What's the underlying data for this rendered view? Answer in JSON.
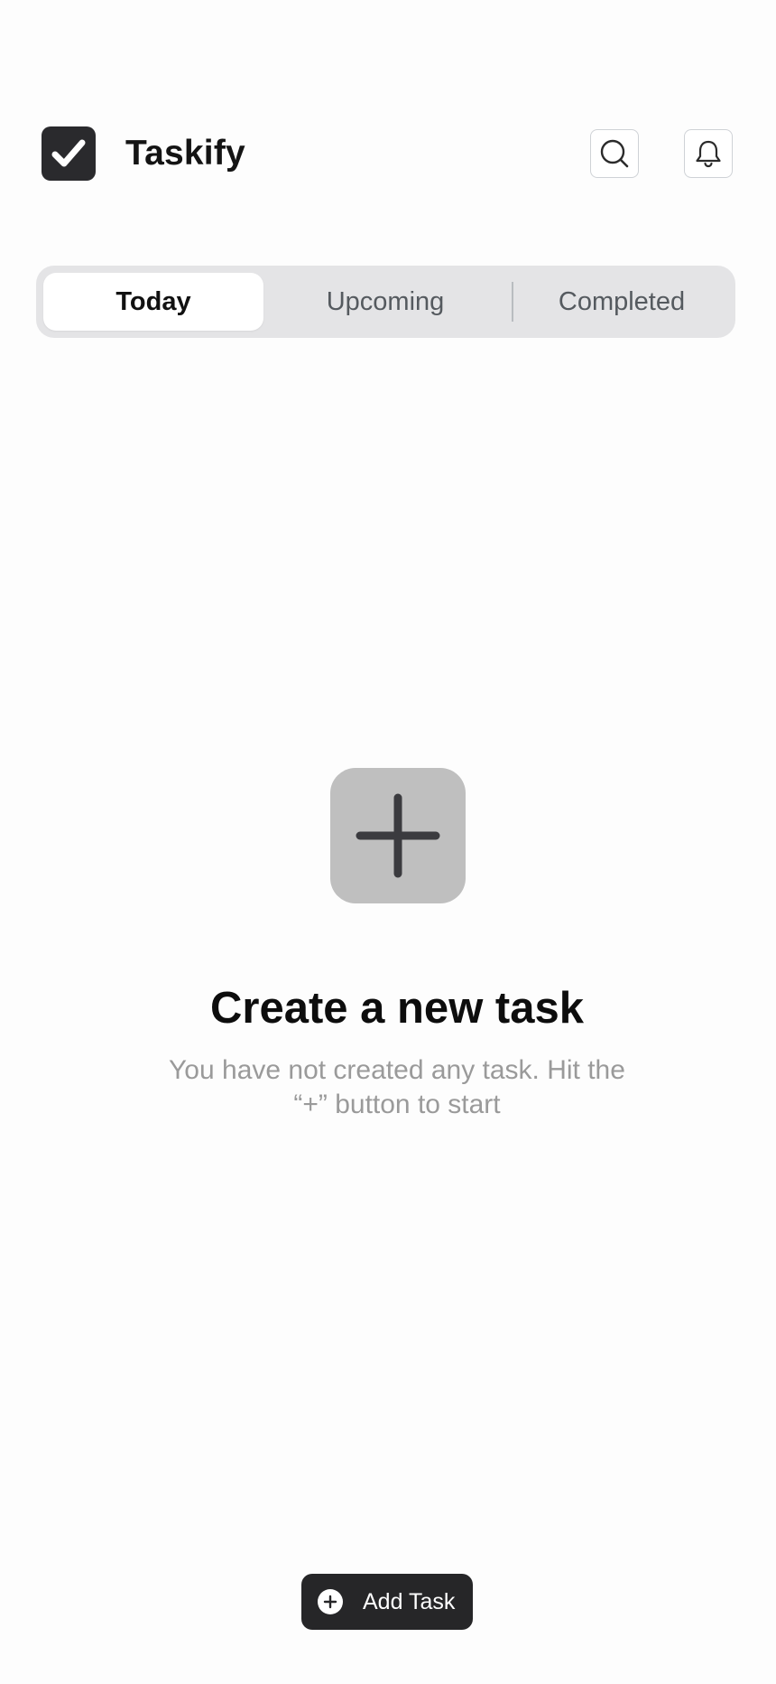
{
  "app": {
    "title": "Taskify",
    "logo_icon": "checkbox-check-icon",
    "brand_color": "#2a2a2d"
  },
  "header": {
    "search_icon": "search-icon",
    "notifications_icon": "bell-icon"
  },
  "tabs": [
    {
      "label": "Today",
      "active": true
    },
    {
      "label": "Upcoming",
      "active": false
    },
    {
      "label": "Completed",
      "active": false
    }
  ],
  "empty_state": {
    "icon": "plus-icon",
    "title": "Create a new task",
    "subtitle": "You have not created any task. Hit the “+” button to start"
  },
  "add_task_button": {
    "label": "Add Task",
    "icon": "plus-circle-icon"
  },
  "colors": {
    "tab_track": "#e4e4e6",
    "empty_icon_bg": "#bfbfbf",
    "button_bg": "#262628",
    "muted_text": "#9a9a9a"
  }
}
